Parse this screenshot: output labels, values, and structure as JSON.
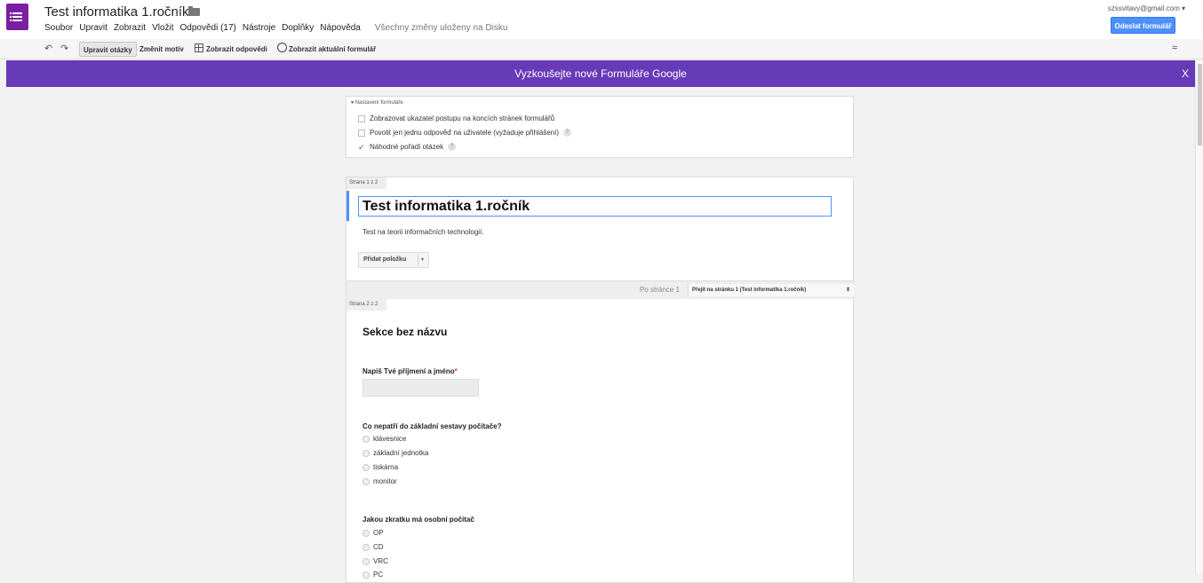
{
  "header": {
    "title": "Test informatika 1.ročník",
    "account": "szssvitavy@gmail.com",
    "send_button": "Odeslat formulář",
    "menu": [
      "Soubor",
      "Upravit",
      "Zobrazit",
      "Vložit",
      "Odpovědi (17)",
      "Nástroje",
      "Doplňky",
      "Nápověda"
    ],
    "saved_status": "Všechny změny uloženy na Disku"
  },
  "toolbar": {
    "edit_questions": "Upravit otázky",
    "change_theme": "Změnit motiv",
    "view_responses": "Zobrazit odpovědi",
    "view_live_form": "Zobrazit aktuální formulář"
  },
  "banner": {
    "text": "Vyzkoušejte nové Formuláře Google",
    "close": "X"
  },
  "settings": {
    "title": "Nastavení formuláře",
    "options": [
      {
        "label": "Zobrazovat ukazatel postupu na koncích stránek formulářů",
        "checked": false
      },
      {
        "label": "Povolit jen jednu odpověď na uživatele (vyžaduje přihlášení)",
        "checked": false
      },
      {
        "label": "Náhodné pořadí otázek",
        "checked": true
      }
    ],
    "help_glyph": "?"
  },
  "page1": {
    "label": "Strana 1 z 2",
    "title": "Test informatika 1.ročník",
    "description": "Test na teorii informačních technologií.",
    "add_item": "Přidat položku"
  },
  "page_nav": {
    "after_page": "Po stránce 1",
    "goto": "Přejít na stránku 1 (Test informatika 1.ročník)"
  },
  "page2": {
    "label": "Strana 2 z 2",
    "section_title": "Sekce bez názvu",
    "questions": [
      {
        "label": "Napiš Tvé příjmení a jméno",
        "required_mark": "*"
      },
      {
        "label": "Co nepatří do základní sestavy počítače?",
        "options": [
          "klávesnice",
          "základní jednotka",
          "tiskárna",
          "monitor"
        ]
      },
      {
        "label": "Jakou zkratku má osobní počítač",
        "options": [
          "OP",
          "CD",
          "VRC",
          "PC"
        ]
      }
    ]
  }
}
